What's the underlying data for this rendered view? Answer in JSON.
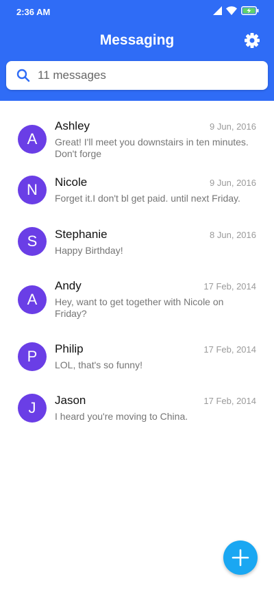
{
  "status_bar": {
    "time": "2:36 AM",
    "icons": [
      "signal-icon",
      "wifi-icon",
      "battery-charging-icon"
    ]
  },
  "header": {
    "title": "Messaging",
    "settings_icon": "gear-icon",
    "background_color": "#2f6cf6"
  },
  "search": {
    "icon": "search-icon",
    "placeholder": "11 messages",
    "value": ""
  },
  "conversations": [
    {
      "initial": "A",
      "name": "Ashley",
      "date": "9 Jun, 2016",
      "preview": "Great! I'll meet you downstairs in ten minutes. Don't forge"
    },
    {
      "initial": "N",
      "name": "Nicole",
      "date": "9 Jun, 2016",
      "preview": "Forget it.I don't bl get paid. until next Friday."
    },
    {
      "initial": "S",
      "name": "Stephanie",
      "date": "8 Jun, 2016",
      "preview": "Happy Birthday!"
    },
    {
      "initial": "A",
      "name": "Andy",
      "date": "17 Feb, 2014",
      "preview": "Hey, want to get together with Nicole on Friday?"
    },
    {
      "initial": "P",
      "name": "Philip",
      "date": "17 Feb, 2014",
      "preview": "LOL, that's so funny!"
    },
    {
      "initial": "J",
      "name": "Jason",
      "date": "17 Feb, 2014",
      "preview": "I heard you're moving to China."
    }
  ],
  "colors": {
    "avatar": "#6a3ee6",
    "fab": "#1aa7f2"
  },
  "fab": {
    "icon": "plus-icon"
  }
}
